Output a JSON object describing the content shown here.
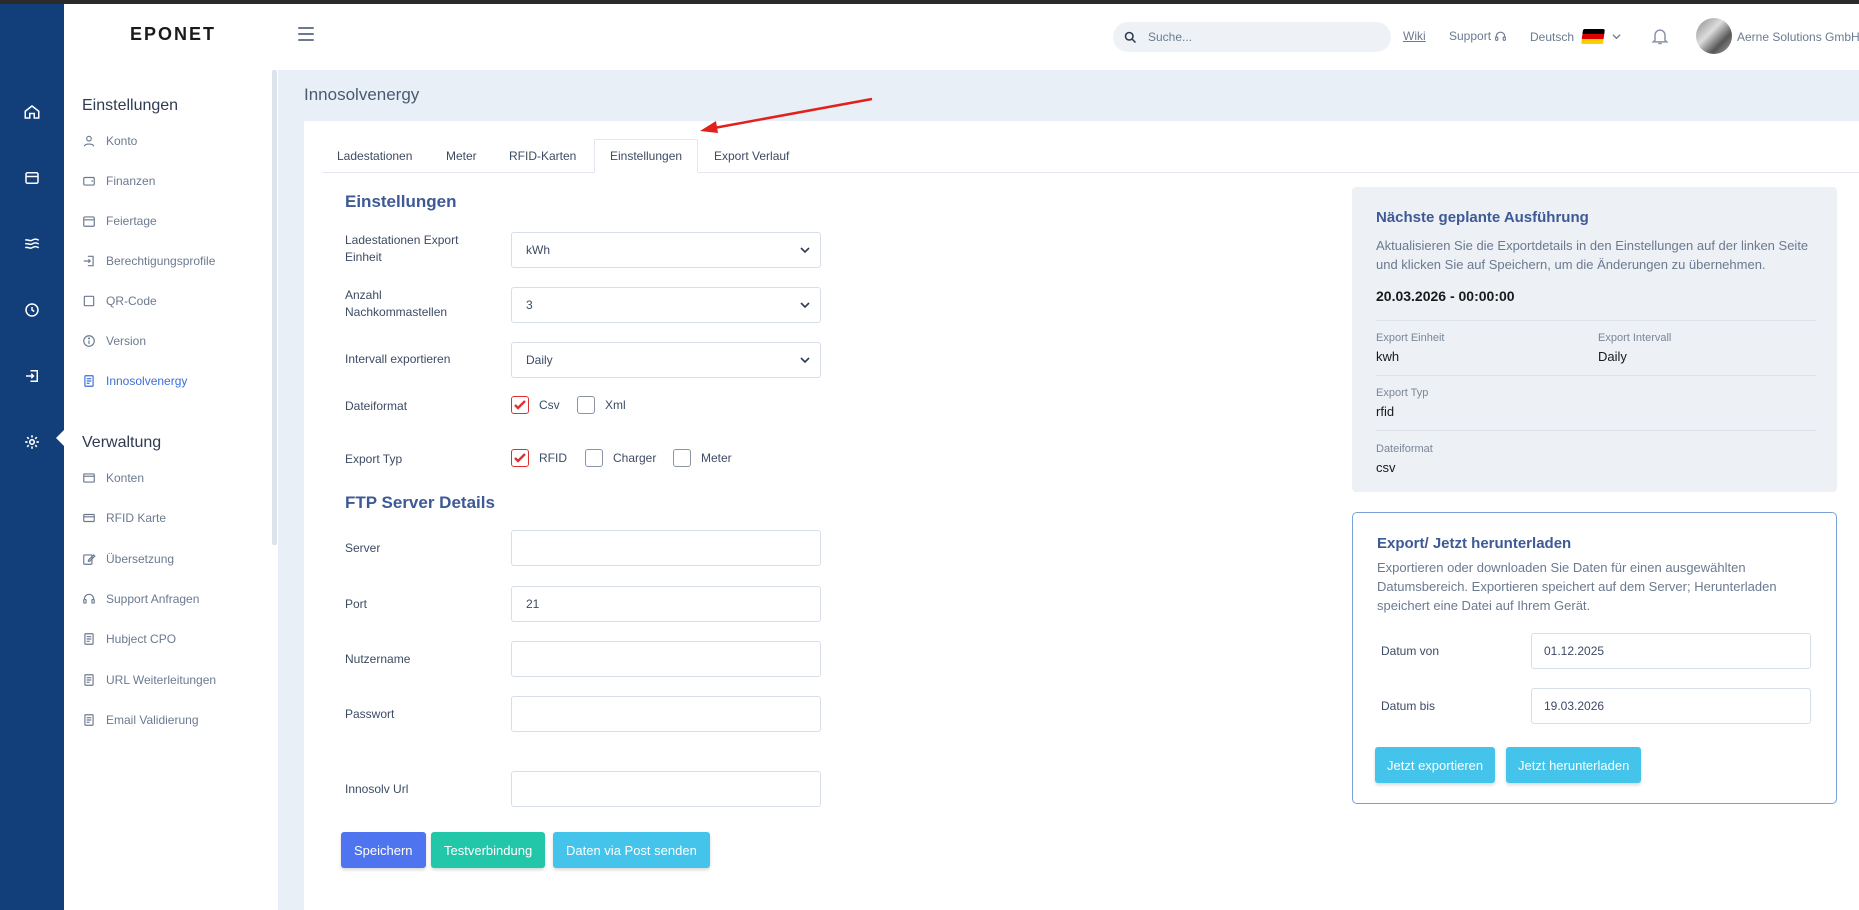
{
  "brand": {
    "logo": "EPONET"
  },
  "colors": {
    "rail_bg": "#123f7a",
    "accent_blue": "#4f74f0",
    "teal": "#22c6a8",
    "cyan": "#44c4ea",
    "red": "#e03131"
  },
  "header": {
    "search_placeholder": "Suche...",
    "wiki": "Wiki",
    "support": "Support",
    "language": "Deutsch",
    "company": "Aerne Solutions GmbH"
  },
  "rail": {
    "icons": [
      "home-icon",
      "store-icon",
      "waves-icon",
      "clock-icon",
      "login-icon",
      "settings-icon"
    ]
  },
  "sidebar": {
    "section1": "Einstellungen",
    "items1": [
      {
        "label": "Konto",
        "icon": "user-icon"
      },
      {
        "label": "Finanzen",
        "icon": "wallet-icon"
      },
      {
        "label": "Feiertage",
        "icon": "calendar-icon"
      },
      {
        "label": "Berechtigungsprofile",
        "icon": "login-icon"
      },
      {
        "label": "QR-Code",
        "icon": "square-icon"
      },
      {
        "label": "Version",
        "icon": "info-icon"
      },
      {
        "label": "Innosolvenergy",
        "icon": "document-icon"
      }
    ],
    "section2": "Verwaltung",
    "items2": [
      {
        "label": "Konten",
        "icon": "window-icon"
      },
      {
        "label": "RFID Karte",
        "icon": "card-icon"
      },
      {
        "label": "Übersetzung",
        "icon": "edit-icon"
      },
      {
        "label": "Support Anfragen",
        "icon": "headset-icon"
      },
      {
        "label": "Hubject CPO",
        "icon": "document-icon"
      },
      {
        "label": "URL Weiterleitungen",
        "icon": "document-icon"
      },
      {
        "label": "Email Validierung",
        "icon": "document-icon"
      }
    ]
  },
  "page": {
    "title": "Innosolvenergy"
  },
  "tabs": [
    "Ladestationen",
    "Meter",
    "RFID-Karten",
    "Einstellungen",
    "Export Verlauf"
  ],
  "settings": {
    "title": "Einstellungen",
    "unit_label": "Ladestationen Export Einheit",
    "unit_value": "kWh",
    "decimals_label": "Anzahl Nachkommastellen",
    "decimals_value": "3",
    "interval_label": "Intervall exportieren",
    "interval_value": "Daily",
    "format_label": "Dateiformat",
    "formats": [
      {
        "label": "Csv",
        "checked": true
      },
      {
        "label": "Xml",
        "checked": false
      }
    ],
    "type_label": "Export Typ",
    "types": [
      {
        "label": "RFID",
        "checked": true
      },
      {
        "label": "Charger",
        "checked": false
      },
      {
        "label": "Meter",
        "checked": false
      }
    ]
  },
  "ftp": {
    "title": "FTP Server Details",
    "server_label": "Server",
    "server_value": "",
    "port_label": "Port",
    "port_value": "21",
    "user_label": "Nutzername",
    "user_value": "",
    "pass_label": "Passwort",
    "pass_value": "",
    "url_label": "Innosolv Url",
    "url_value": ""
  },
  "buttons": {
    "save": "Speichern",
    "test": "Testverbindung",
    "post": "Daten via Post senden"
  },
  "next_run": {
    "title": "Nächste geplante Ausführung",
    "desc": "Aktualisieren Sie die Exportdetails in den Einstellungen auf der linken Seite und klicken Sie auf Speichern, um die Änderungen zu übernehmen.",
    "datetime": "20.03.2026 - 00:00:00",
    "unit_label": "Export Einheit",
    "unit_value": "kwh",
    "interval_label": "Export Intervall",
    "interval_value": "Daily",
    "type_label": "Export Typ",
    "type_value": "rfid",
    "format_label": "Dateiformat",
    "format_value": "csv"
  },
  "export": {
    "title": "Export/ Jetzt herunterladen",
    "desc": "Exportieren oder downloaden Sie Daten für einen ausgewählten Datumsbereich. Exportieren speichert auf dem Server; Herunterladen speichert eine Datei auf Ihrem Gerät.",
    "from_label": "Datum von",
    "from_value": "01.12.2025",
    "to_label": "Datum bis",
    "to_value": "19.03.2026",
    "export_btn": "Jetzt exportieren",
    "download_btn": "Jetzt herunterladen"
  }
}
